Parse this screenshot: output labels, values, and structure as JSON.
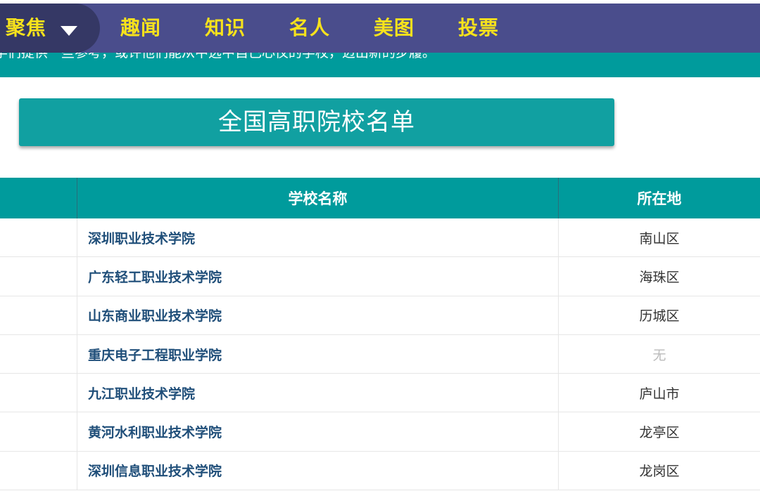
{
  "nav": {
    "focus_label": "聚焦",
    "items": [
      "趣闻",
      "知识",
      "名人",
      "美图",
      "投票"
    ]
  },
  "banner": {
    "text": "学们提供一些参考，或许他们能从中选中自己心仪的学校，迈出新的步履。"
  },
  "title": "全国高职院校名单",
  "table": {
    "headers": {
      "first": "",
      "name": "学校名称",
      "location": "所在地"
    },
    "rows": [
      {
        "name": "深圳职业技术学院",
        "location": "南山区"
      },
      {
        "name": "广东轻工职业技术学院",
        "location": "海珠区"
      },
      {
        "name": "山东商业职业技术学院",
        "location": "历城区"
      },
      {
        "name": "重庆电子工程职业学院",
        "location": "无"
      },
      {
        "name": "九江职业技术学院",
        "location": "庐山市"
      },
      {
        "name": "黄河水利职业技术学院",
        "location": "龙亭区"
      },
      {
        "name": "深圳信息职业技术学院",
        "location": "龙岗区"
      }
    ]
  },
  "colors": {
    "nav_bg": "#4a4d8c",
    "nav_text": "#f7e21c",
    "teal": "#009b9c",
    "link": "#1f4e79"
  }
}
